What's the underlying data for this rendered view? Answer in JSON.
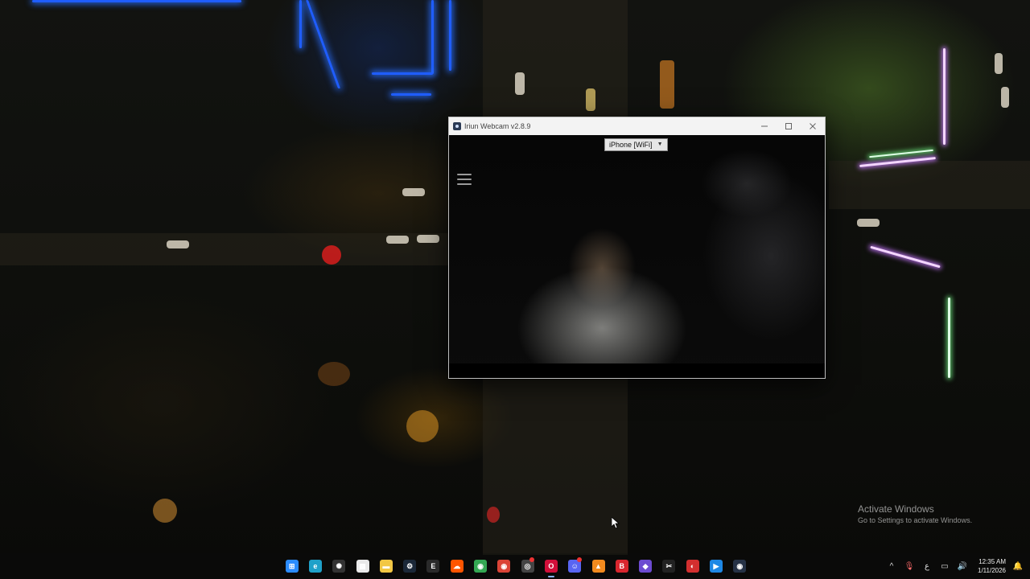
{
  "window": {
    "title": "Iriun Webcam v2.8.9",
    "device_select": {
      "value": "iPhone [WiFi]"
    }
  },
  "watermark": {
    "line1": "Activate Windows",
    "line2": "Go to Settings to activate Windows."
  },
  "taskbar": {
    "apps": [
      {
        "name": "start-icon",
        "glyph": "⊞",
        "color": "#2b8cff"
      },
      {
        "name": "edge-icon",
        "glyph": "e",
        "color": "#1fa1c9"
      },
      {
        "name": "steelseries-icon",
        "glyph": "✺",
        "color": "#333333"
      },
      {
        "name": "store-icon",
        "glyph": "▦",
        "color": "#e9e9e9"
      },
      {
        "name": "file-explorer-icon",
        "glyph": "▬",
        "color": "#f2c744"
      },
      {
        "name": "steam-icon",
        "glyph": "⚙",
        "color": "#1b2838"
      },
      {
        "name": "epic-games-icon",
        "glyph": "E",
        "color": "#2a2a2a"
      },
      {
        "name": "soundcloud-icon",
        "glyph": "☁",
        "color": "#ff5500"
      },
      {
        "name": "chrome-icon",
        "glyph": "◉",
        "color": "#34a853"
      },
      {
        "name": "chrome-profile-icon",
        "glyph": "◉",
        "color": "#db4437"
      },
      {
        "name": "app-spiral-icon",
        "glyph": "◎",
        "color": "#444444"
      },
      {
        "name": "opera-gx-icon",
        "glyph": "O",
        "color": "#d10f3a"
      },
      {
        "name": "discord-icon",
        "glyph": "☺",
        "color": "#5865f2"
      },
      {
        "name": "vlc-icon",
        "glyph": "▲",
        "color": "#f28a1e"
      },
      {
        "name": "bandicam-icon",
        "glyph": "B",
        "color": "#d9262e"
      },
      {
        "name": "visual-studio-icon",
        "glyph": "◆",
        "color": "#6c4bd1"
      },
      {
        "name": "capcut-icon",
        "glyph": "✂",
        "color": "#222222"
      },
      {
        "name": "app-red-icon",
        "glyph": "◐",
        "color": "#d32f2f"
      },
      {
        "name": "app-blue-icon",
        "glyph": "▶",
        "color": "#1e88e5"
      },
      {
        "name": "iriun-webcam-icon",
        "glyph": "◉",
        "color": "#263246"
      }
    ],
    "clock": {
      "time": "12:35 AM",
      "date": "1/11/2026"
    }
  }
}
